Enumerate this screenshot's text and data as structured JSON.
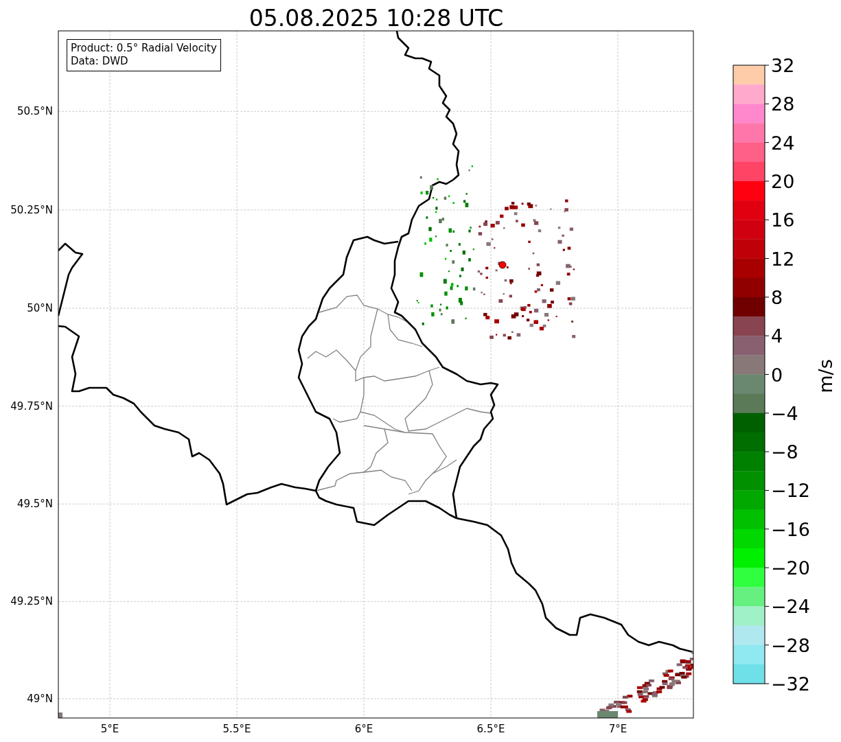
{
  "title": "05.08.2025 10:28 UTC",
  "info_box": {
    "lines": [
      "Product: 0.5° Radial Velocity",
      "Data: DWD"
    ]
  },
  "map": {
    "xticks": [
      "5°E",
      "5.5°E",
      "6°E",
      "6.5°E",
      "7°E"
    ],
    "yticks": [
      "50.5°N",
      "50.25°N",
      "50°N",
      "49.75°N",
      "49.5°N",
      "49.25°N",
      "49°N"
    ]
  },
  "colorbar": {
    "label": "m/s",
    "ticks": [
      "32",
      "28",
      "24",
      "20",
      "16",
      "12",
      "8",
      "4",
      "0",
      "−4",
      "−8",
      "−12",
      "−16",
      "−20",
      "−24",
      "−28",
      "−32"
    ],
    "bins": [
      {
        "color": "#ffccaa"
      },
      {
        "color": "#ffaacc"
      },
      {
        "color": "#ff88cc"
      },
      {
        "color": "#ff77aa"
      },
      {
        "color": "#ff6088"
      },
      {
        "color": "#ff4466"
      },
      {
        "color": "#ff0010"
      },
      {
        "color": "#e00010"
      },
      {
        "color": "#d00010"
      },
      {
        "color": "#c00008"
      },
      {
        "color": "#a80000"
      },
      {
        "color": "#900000"
      },
      {
        "color": "#700000"
      },
      {
        "color": "#884450"
      },
      {
        "color": "#886070"
      },
      {
        "color": "#887878"
      },
      {
        "color": "#6a8870"
      },
      {
        "color": "#5a7a58"
      },
      {
        "color": "#006000"
      },
      {
        "color": "#006e00"
      },
      {
        "color": "#008000"
      },
      {
        "color": "#009000"
      },
      {
        "color": "#00a800"
      },
      {
        "color": "#00c000"
      },
      {
        "color": "#00d800"
      },
      {
        "color": "#00f000"
      },
      {
        "color": "#30ff40"
      },
      {
        "color": "#66f080"
      },
      {
        "color": "#a0f0c8"
      },
      {
        "color": "#b0e8f0"
      },
      {
        "color": "#90e8f0"
      },
      {
        "color": "#70e0e8"
      }
    ]
  }
}
